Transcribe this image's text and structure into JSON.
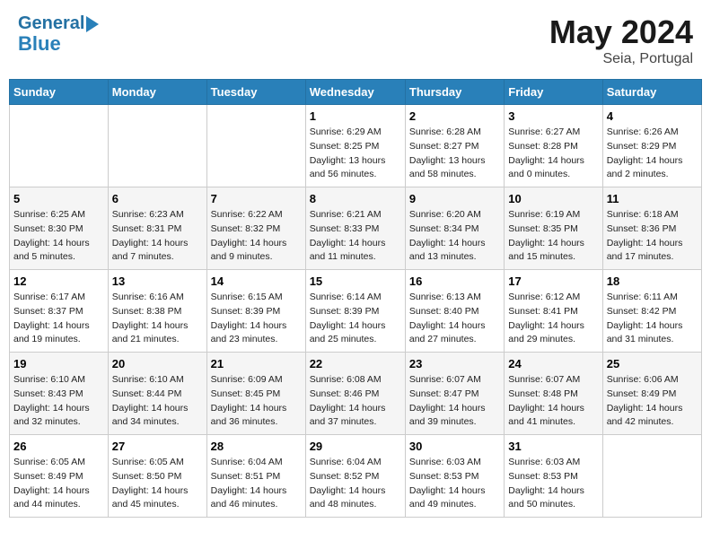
{
  "header": {
    "logo_line1": "General",
    "logo_line2": "Blue",
    "month_year": "May 2024",
    "location": "Seia, Portugal"
  },
  "weekdays": [
    "Sunday",
    "Monday",
    "Tuesday",
    "Wednesday",
    "Thursday",
    "Friday",
    "Saturday"
  ],
  "weeks": [
    [
      {
        "day": "",
        "info": ""
      },
      {
        "day": "",
        "info": ""
      },
      {
        "day": "",
        "info": ""
      },
      {
        "day": "1",
        "info": "Sunrise: 6:29 AM\nSunset: 8:25 PM\nDaylight: 13 hours and 56 minutes."
      },
      {
        "day": "2",
        "info": "Sunrise: 6:28 AM\nSunset: 8:27 PM\nDaylight: 13 hours and 58 minutes."
      },
      {
        "day": "3",
        "info": "Sunrise: 6:27 AM\nSunset: 8:28 PM\nDaylight: 14 hours and 0 minutes."
      },
      {
        "day": "4",
        "info": "Sunrise: 6:26 AM\nSunset: 8:29 PM\nDaylight: 14 hours and 2 minutes."
      }
    ],
    [
      {
        "day": "5",
        "info": "Sunrise: 6:25 AM\nSunset: 8:30 PM\nDaylight: 14 hours and 5 minutes."
      },
      {
        "day": "6",
        "info": "Sunrise: 6:23 AM\nSunset: 8:31 PM\nDaylight: 14 hours and 7 minutes."
      },
      {
        "day": "7",
        "info": "Sunrise: 6:22 AM\nSunset: 8:32 PM\nDaylight: 14 hours and 9 minutes."
      },
      {
        "day": "8",
        "info": "Sunrise: 6:21 AM\nSunset: 8:33 PM\nDaylight: 14 hours and 11 minutes."
      },
      {
        "day": "9",
        "info": "Sunrise: 6:20 AM\nSunset: 8:34 PM\nDaylight: 14 hours and 13 minutes."
      },
      {
        "day": "10",
        "info": "Sunrise: 6:19 AM\nSunset: 8:35 PM\nDaylight: 14 hours and 15 minutes."
      },
      {
        "day": "11",
        "info": "Sunrise: 6:18 AM\nSunset: 8:36 PM\nDaylight: 14 hours and 17 minutes."
      }
    ],
    [
      {
        "day": "12",
        "info": "Sunrise: 6:17 AM\nSunset: 8:37 PM\nDaylight: 14 hours and 19 minutes."
      },
      {
        "day": "13",
        "info": "Sunrise: 6:16 AM\nSunset: 8:38 PM\nDaylight: 14 hours and 21 minutes."
      },
      {
        "day": "14",
        "info": "Sunrise: 6:15 AM\nSunset: 8:39 PM\nDaylight: 14 hours and 23 minutes."
      },
      {
        "day": "15",
        "info": "Sunrise: 6:14 AM\nSunset: 8:39 PM\nDaylight: 14 hours and 25 minutes."
      },
      {
        "day": "16",
        "info": "Sunrise: 6:13 AM\nSunset: 8:40 PM\nDaylight: 14 hours and 27 minutes."
      },
      {
        "day": "17",
        "info": "Sunrise: 6:12 AM\nSunset: 8:41 PM\nDaylight: 14 hours and 29 minutes."
      },
      {
        "day": "18",
        "info": "Sunrise: 6:11 AM\nSunset: 8:42 PM\nDaylight: 14 hours and 31 minutes."
      }
    ],
    [
      {
        "day": "19",
        "info": "Sunrise: 6:10 AM\nSunset: 8:43 PM\nDaylight: 14 hours and 32 minutes."
      },
      {
        "day": "20",
        "info": "Sunrise: 6:10 AM\nSunset: 8:44 PM\nDaylight: 14 hours and 34 minutes."
      },
      {
        "day": "21",
        "info": "Sunrise: 6:09 AM\nSunset: 8:45 PM\nDaylight: 14 hours and 36 minutes."
      },
      {
        "day": "22",
        "info": "Sunrise: 6:08 AM\nSunset: 8:46 PM\nDaylight: 14 hours and 37 minutes."
      },
      {
        "day": "23",
        "info": "Sunrise: 6:07 AM\nSunset: 8:47 PM\nDaylight: 14 hours and 39 minutes."
      },
      {
        "day": "24",
        "info": "Sunrise: 6:07 AM\nSunset: 8:48 PM\nDaylight: 14 hours and 41 minutes."
      },
      {
        "day": "25",
        "info": "Sunrise: 6:06 AM\nSunset: 8:49 PM\nDaylight: 14 hours and 42 minutes."
      }
    ],
    [
      {
        "day": "26",
        "info": "Sunrise: 6:05 AM\nSunset: 8:49 PM\nDaylight: 14 hours and 44 minutes."
      },
      {
        "day": "27",
        "info": "Sunrise: 6:05 AM\nSunset: 8:50 PM\nDaylight: 14 hours and 45 minutes."
      },
      {
        "day": "28",
        "info": "Sunrise: 6:04 AM\nSunset: 8:51 PM\nDaylight: 14 hours and 46 minutes."
      },
      {
        "day": "29",
        "info": "Sunrise: 6:04 AM\nSunset: 8:52 PM\nDaylight: 14 hours and 48 minutes."
      },
      {
        "day": "30",
        "info": "Sunrise: 6:03 AM\nSunset: 8:53 PM\nDaylight: 14 hours and 49 minutes."
      },
      {
        "day": "31",
        "info": "Sunrise: 6:03 AM\nSunset: 8:53 PM\nDaylight: 14 hours and 50 minutes."
      },
      {
        "day": "",
        "info": ""
      }
    ]
  ]
}
